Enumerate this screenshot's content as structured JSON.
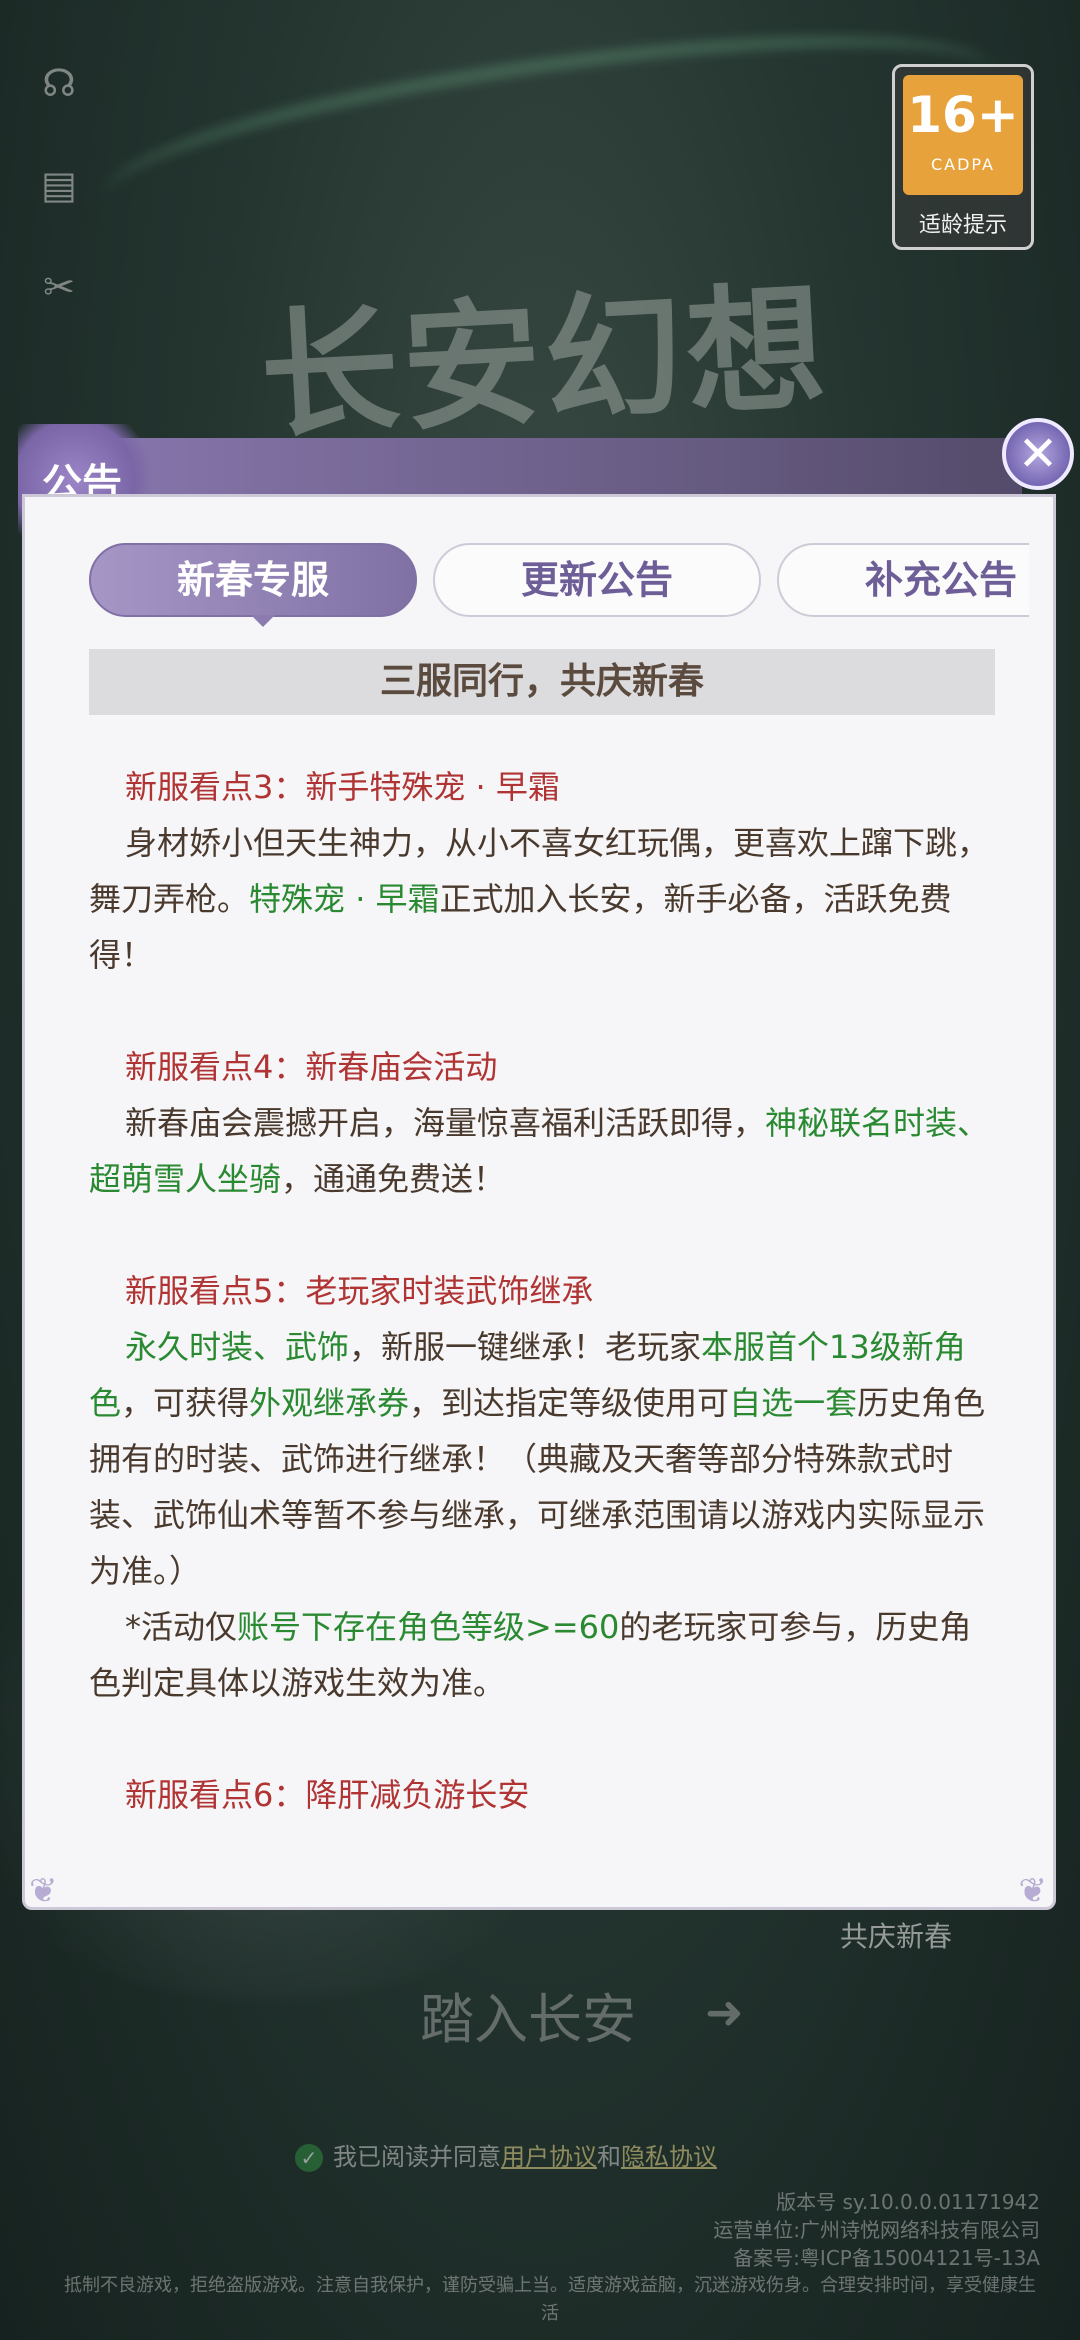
{
  "background": {
    "game_logo": "长安幻想",
    "age_rating": {
      "number": "16+",
      "sub": "CADPA",
      "tip": "适龄提示"
    },
    "slogan": "共庆新春",
    "enter_button": "踏入长安",
    "agreement": {
      "prefix": "我已阅读并同意",
      "user_agreement": "用户协议",
      "and": "和",
      "privacy": "隐私协议"
    },
    "footer": {
      "version": "版本号 sy.10.0.0.01171942",
      "operator": "运营单位:广州诗悦网络科技有限公司",
      "icp": "备案号:粤ICP备15004121号-13A",
      "health": "抵制不良游戏，拒绝盗版游戏。注意自我保护，谨防受骗上当。适度游戏益脑，沉迷游戏伤身。合理安排时间，享受健康生活"
    }
  },
  "dialog": {
    "title": "公告",
    "close_icon": "close-x",
    "tabs": [
      {
        "label": "新春专服",
        "active": true
      },
      {
        "label": "更新公告",
        "active": false
      },
      {
        "label": "补充公告",
        "active": false
      }
    ],
    "banner": "三服同行，共庆新春",
    "sections": {
      "s3": {
        "heading": "新服看点3：新手特殊宠 · 早霜",
        "p1a": "身材娇小但天生神力，从小不喜女红玩偶，更喜欢上蹿下跳，舞刀弄枪。",
        "p1b": "特殊宠 · 早霜",
        "p1c": "正式加入长安，新手必备，活跃免费得！"
      },
      "s4": {
        "heading": "新服看点4：新春庙会活动",
        "p1a": "新春庙会震撼开启，海量惊喜福利活跃即得，",
        "p1b": "神秘联名时装、超萌雪人坐骑",
        "p1c": "，通通免费送！"
      },
      "s5": {
        "heading": "新服看点5：老玩家时装武饰继承",
        "p1a": "永久时装、武饰",
        "p1b": "，新服一键继承！老玩家",
        "p1c": "本服首个13级新角色",
        "p1d": "，可获得",
        "p1e": "外观继承券",
        "p1f": "，到达指定等级使用可",
        "p1g": "自选一套",
        "p1h": "历史角色拥有的时装、武饰进行继承！（典藏及天奢等部分特殊款式时装、武饰仙术等暂不参与继承，可继承范围请以游戏内实际显示为准。）",
        "p2a": "*活动仅",
        "p2b": "账号下存在角色等级>=60",
        "p2c": "的老玩家可参与，历史角色判定具体以游戏生效为准。"
      },
      "s6": {
        "heading": "新服看点6：降肝减负游长安"
      }
    }
  },
  "colors": {
    "accent_purple": "#8071a5",
    "heading_red": "#b03434",
    "highlight_green": "#2a8a32"
  }
}
